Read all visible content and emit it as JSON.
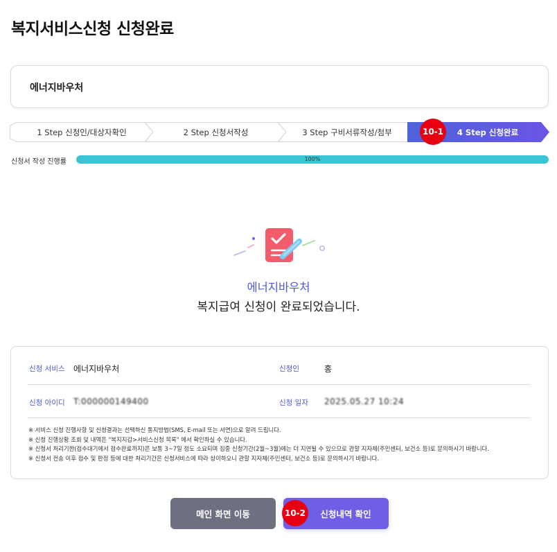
{
  "page": {
    "title": "복지서비스신청 신청완료"
  },
  "service_card": {
    "name": "에너지바우처"
  },
  "steps": [
    {
      "label": "1 Step 신청인/대상자확인",
      "active": false
    },
    {
      "label": "2 Step 신청서작성",
      "active": false
    },
    {
      "label": "3 Step 구비서류작성/첨부",
      "active": false
    },
    {
      "label": "4 Step 신청완료",
      "active": true
    }
  ],
  "progress": {
    "label": "신청서 작성 진행률",
    "value_text": "100%",
    "percent": 100
  },
  "completion": {
    "service": "에너지바우처",
    "message": "복지급여 신청이 완료되었습니다."
  },
  "details": {
    "service_label": "신청 서비스",
    "service_value": "에너지바우처",
    "applicant_label": "신청인",
    "applicant_value": "홍",
    "id_label": "신청 아이디",
    "id_value": "T:000000149400",
    "date_label": "신청 일자",
    "date_value": "2025.05.27 10:24",
    "notes": [
      "※ 서비스 신청 진행사항 및 신청결과는 선택하신 통지방법(SMS, E-mail 또는 서면)으로 알려 드립니다.",
      "※ 신청 진행상황 조회 및 내역은 \"복지지갑>서비스신청 목록\" 에서 확인하실 수 있습니다.",
      "※ 신청서 처리기한(접수대기에서 접수완료까지)은 보통 3~7일 정도 소요되며 집중 신청기간(2월~3월)에는 더 지연될 수 있으므로 관할 지자체(주민센터, 보건소 등)로 문의하시기 바랍니다.",
      "※ 신청서 전송 이후 접수 및 판정 등에 대한 처리기간은 신청서비스에 따라 상이하오니 관할 지자체(주민센터, 보건소 등)로 문의하시기 바랍니다."
    ]
  },
  "buttons": {
    "main": "메인 화면 이동",
    "check": "신청내역 확인"
  },
  "annotations": {
    "badge1": "10-1",
    "badge2": "10-2"
  },
  "colors": {
    "accent": "#4f5bd5",
    "active_step": "#5c5ce0",
    "progress": "#3bc5d4",
    "badge": "#e60012",
    "button_gray": "#6e7081",
    "button_purple": "#6f5ee6"
  }
}
